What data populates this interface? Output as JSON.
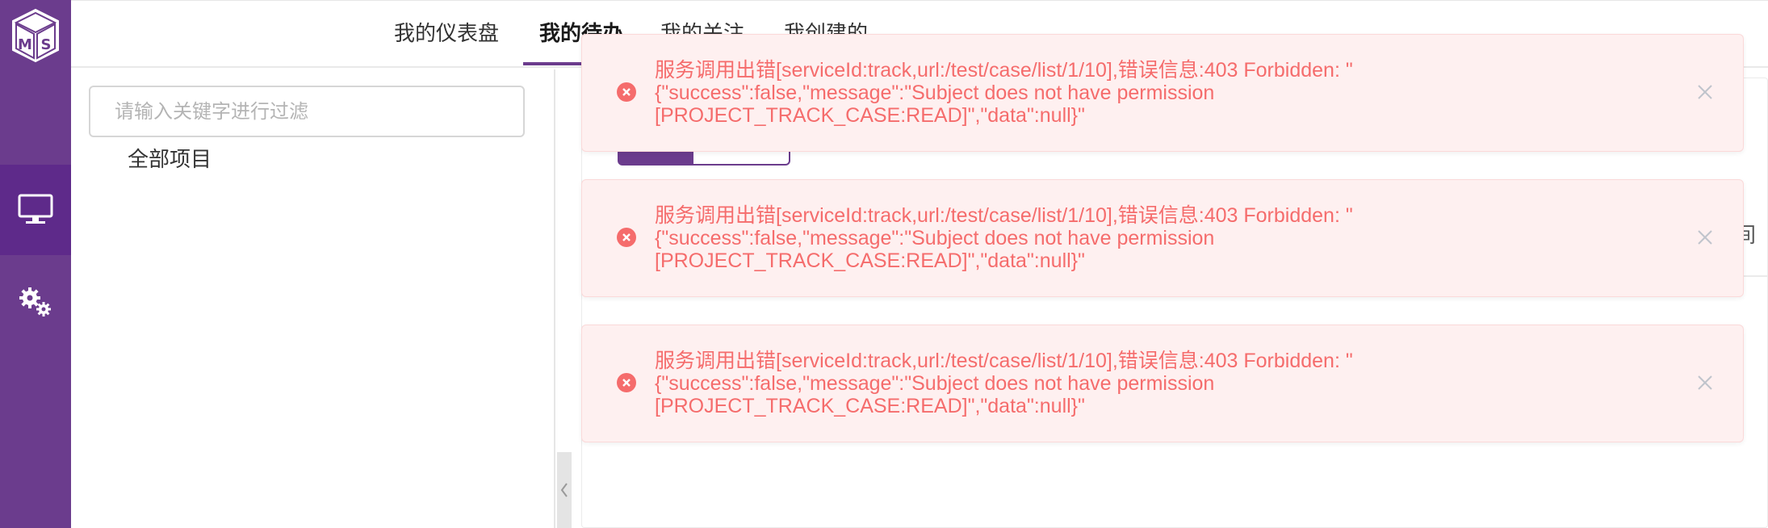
{
  "brand": {
    "logo_letters": [
      "M",
      "S"
    ],
    "colors": {
      "sidebar": "#6b3c8d",
      "active": "#5e2a8a",
      "error": "#f56c6c",
      "error_bg": "#fef0f0"
    }
  },
  "sidebar": {
    "items": [
      {
        "icon": "monitor-icon",
        "active": true
      },
      {
        "icon": "gears-icon",
        "active": false
      }
    ]
  },
  "topnav": {
    "tabs": [
      {
        "label": "我的仪表盘"
      },
      {
        "label": "我的待办"
      },
      {
        "label": "我的关注"
      },
      {
        "label": "我创建的"
      }
    ],
    "active_index": 1
  },
  "tree": {
    "filter_placeholder": "请输入关键字进行过滤",
    "root_label": "全部项目"
  },
  "content": {
    "header_fragment": "间"
  },
  "toasts": [
    {
      "icon": "error-circle-icon",
      "lines": [
        "服务调用出错[serviceId:track,url:/test/case/list/1/10],错误信息:403 Forbidden: \"",
        "{\"success\":false,\"message\":\"Subject does not have permission",
        "[PROJECT_TRACK_CASE:READ]\",\"data\":null}\""
      ]
    },
    {
      "icon": "error-circle-icon",
      "lines": [
        "服务调用出错[serviceId:track,url:/test/case/list/1/10],错误信息:403 Forbidden: \"",
        "{\"success\":false,\"message\":\"Subject does not have permission",
        "[PROJECT_TRACK_CASE:READ]\",\"data\":null}\""
      ]
    },
    {
      "icon": "error-circle-icon",
      "lines": [
        "服务调用出错[serviceId:track,url:/test/case/list/1/10],错误信息:403 Forbidden: \"",
        "{\"success\":false,\"message\":\"Subject does not have permission",
        "[PROJECT_TRACK_CASE:READ]\",\"data\":null}\""
      ]
    }
  ]
}
